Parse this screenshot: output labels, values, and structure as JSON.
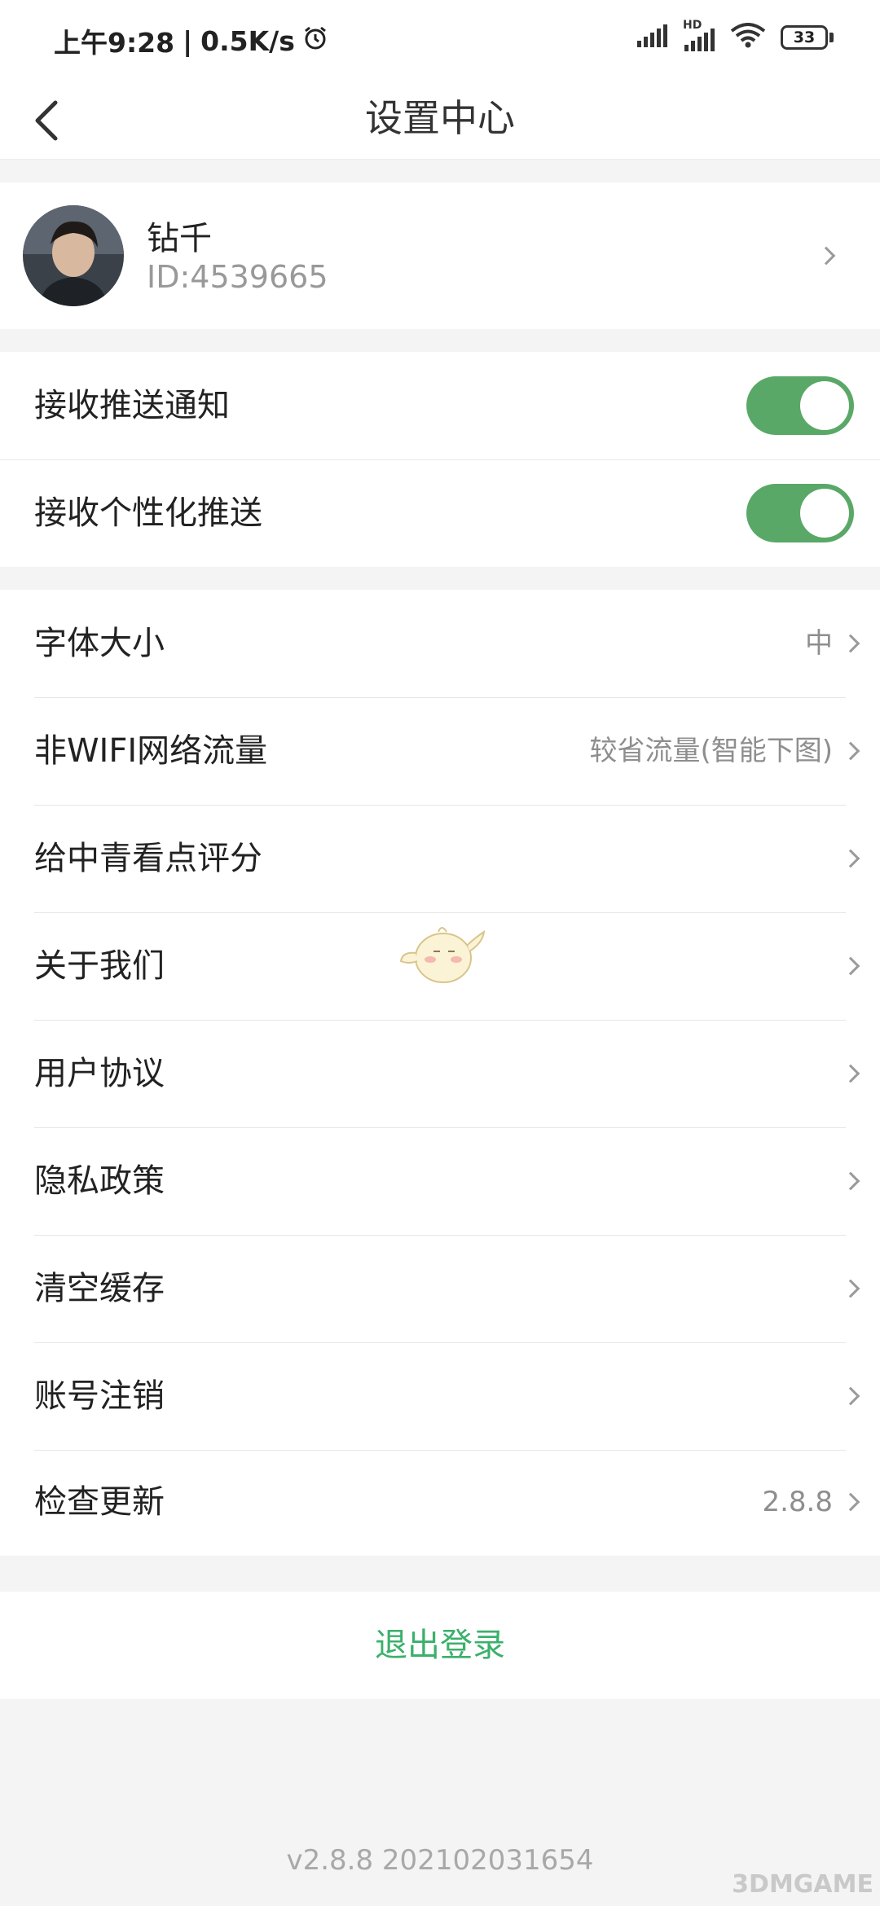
{
  "status_bar": {
    "time": "上午9:28",
    "speed": "0.5K/s",
    "network_badge": "HD",
    "battery": "33",
    "icons": [
      "alarm-icon",
      "signal-icon",
      "signal-hd-icon",
      "wifi-icon",
      "battery-icon"
    ]
  },
  "nav": {
    "title": "设置中心",
    "back_icon": "chevron-left-icon"
  },
  "profile": {
    "name": "钻千",
    "id_text": "ID:4539665"
  },
  "toggles": [
    {
      "label": "接收推送通知",
      "on": true
    },
    {
      "label": "接收个性化推送",
      "on": true
    }
  ],
  "settings": [
    {
      "label": "字体大小",
      "value": "中"
    },
    {
      "label": "非WIFI网络流量",
      "value": "较省流量(智能下图)"
    },
    {
      "label": "给中青看点评分",
      "value": ""
    },
    {
      "label": "关于我们",
      "value": ""
    },
    {
      "label": "用户协议",
      "value": ""
    },
    {
      "label": "隐私政策",
      "value": ""
    },
    {
      "label": "清空缓存",
      "value": ""
    },
    {
      "label": "账号注销",
      "value": ""
    },
    {
      "label": "检查更新",
      "value": "2.8.8"
    }
  ],
  "logout_label": "退出登录",
  "version_text": "v2.8.8 202102031654",
  "watermark": "3DMGAME",
  "colors": {
    "accent_green": "#5aa867",
    "logout_green": "#3bb06b",
    "background": "#f4f4f4"
  }
}
